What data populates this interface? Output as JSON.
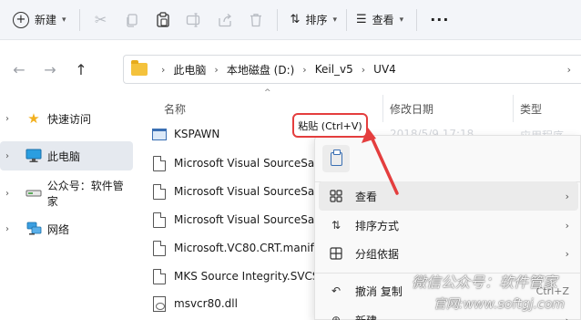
{
  "toolbar": {
    "new_label": "新建",
    "sort_label": "排序",
    "view_label": "查看",
    "more_glyph": "···"
  },
  "address": {
    "crumbs": [
      "此电脑",
      "本地磁盘 (D:)",
      "Keil_v5",
      "UV4"
    ]
  },
  "sidebar": {
    "items": [
      {
        "label": "快速访问",
        "icon": "star-icon"
      },
      {
        "label": "此电脑",
        "icon": "monitor-icon"
      },
      {
        "label": "公众号：软件管家",
        "icon": "drive-icon"
      },
      {
        "label": "网络",
        "icon": "network-icon"
      }
    ]
  },
  "columns": {
    "name": "名称",
    "date": "修改日期",
    "type": "类型"
  },
  "files": [
    {
      "name": "KSPAWN",
      "icon": "exe-icon",
      "date": "2018/5/9 17:18",
      "type": "应用程序"
    },
    {
      "name": "Microsoft Visual SourceSafe",
      "icon": "document-icon"
    },
    {
      "name": "Microsoft Visual SourceSafe",
      "icon": "document-icon"
    },
    {
      "name": "Microsoft Visual SourceSafe",
      "icon": "document-icon"
    },
    {
      "name": "Microsoft.VC80.CRT.manifest",
      "icon": "document-icon"
    },
    {
      "name": "MKS Source Integrity.SVCS",
      "icon": "document-icon"
    },
    {
      "name": "msvcr80.dll",
      "icon": "dll-icon"
    }
  ],
  "context_menu": {
    "tooltip": "粘贴 (Ctrl+V)",
    "items": [
      {
        "label": "查看",
        "icon": "grid-icon",
        "submenu": true
      },
      {
        "label": "排序方式",
        "icon": "sort-icon",
        "submenu": true
      },
      {
        "label": "分组依据",
        "icon": "group-icon",
        "submenu": true
      },
      {
        "label": "撤消 复制",
        "icon": "undo-icon",
        "shortcut": "Ctrl+Z"
      },
      {
        "label": "新建",
        "icon": "new-icon",
        "submenu": true
      }
    ]
  },
  "watermark": {
    "line1": "微信公众号：软件管家",
    "line2": "官网:www.softgj.com"
  },
  "colors": {
    "callout": "#e43e3e",
    "accent": "#3a6fb3"
  }
}
